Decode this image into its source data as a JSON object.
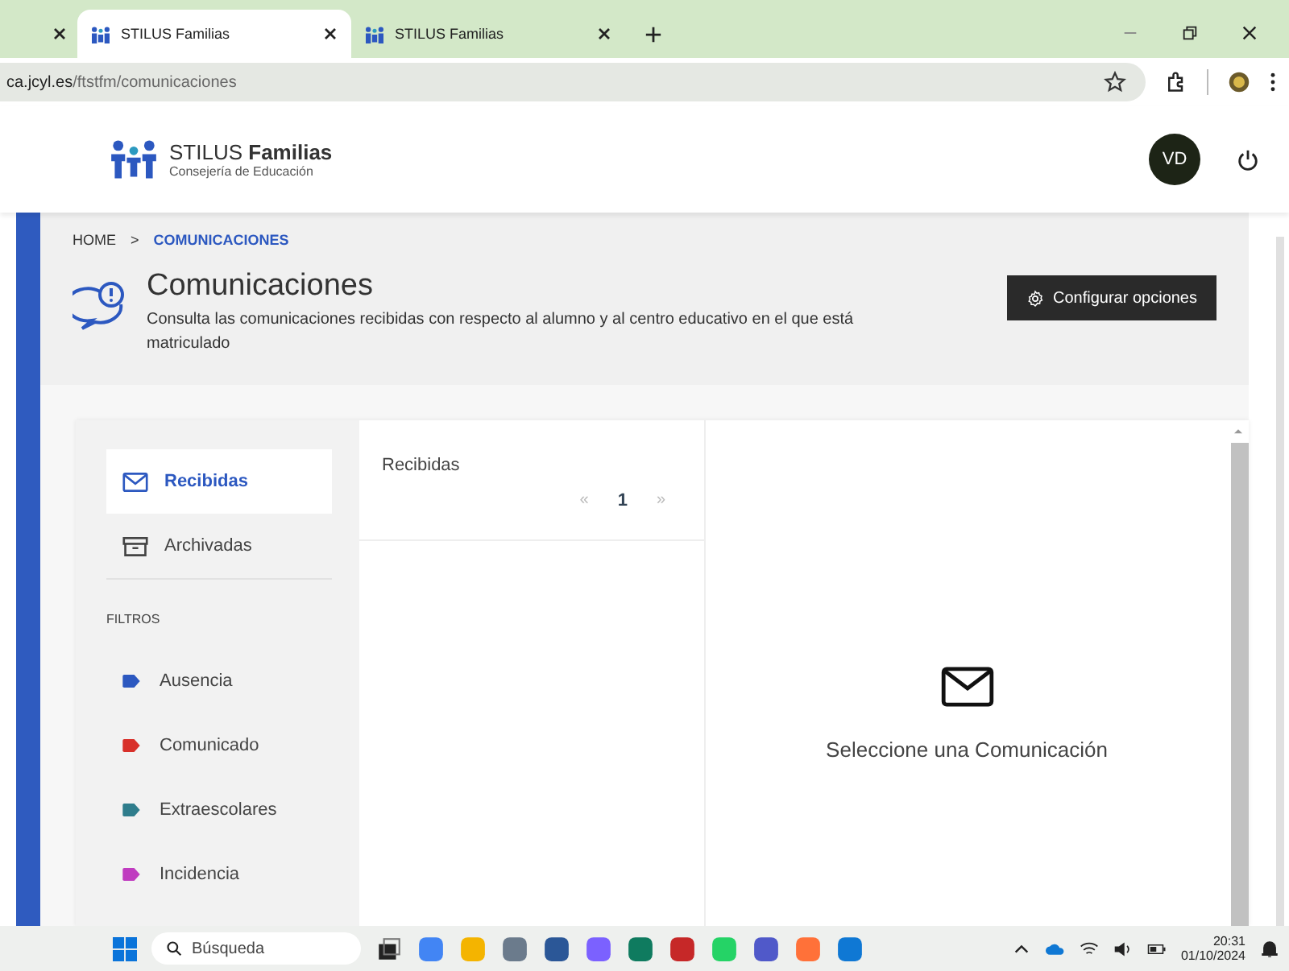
{
  "browser": {
    "tabs": [
      {
        "title": "STILUS Familias",
        "selected": true
      },
      {
        "title": "STILUS Familias",
        "selected": false
      }
    ],
    "address": {
      "host": "ca.jcyl.es",
      "path": "/ftstfm/comunicaciones"
    }
  },
  "header": {
    "brand": "STILUS **Familias**",
    "subtitle": "Consejería de Educación",
    "avatar": "VD"
  },
  "breadcrumb": {
    "items": [
      "HOME",
      "COMUNICACIONES"
    ],
    "separator": ">"
  },
  "page": {
    "title": "Comunicaciones",
    "description": "Consulta las comunicaciones recibidas con respecto al alumno y al centro educativo en el que está matriculado",
    "button": "Configurar opciones"
  },
  "nav": {
    "items": [
      {
        "label": "Recibidas",
        "kind": "inbox",
        "selected": true
      },
      {
        "label": "Archivadas",
        "kind": "archive",
        "selected": false
      }
    ],
    "filters_heading": "FILTROS",
    "filters": [
      {
        "label": "Ausencia",
        "color": "#2c58c0"
      },
      {
        "label": "Comunicado",
        "color": "#d8302a"
      },
      {
        "label": "Extraescolares",
        "color": "#2f7d8c"
      },
      {
        "label": "Incidencia",
        "color": "#c03cc0"
      }
    ]
  },
  "list": {
    "title": "Recibidas",
    "pagination": {
      "prev": "«",
      "page": "1",
      "next": "»"
    }
  },
  "detail": {
    "message": "Seleccione una Comunicación"
  },
  "taskbar": {
    "search_placeholder": "Búsqueda",
    "time": "20:31",
    "date": "01/10/2024"
  }
}
